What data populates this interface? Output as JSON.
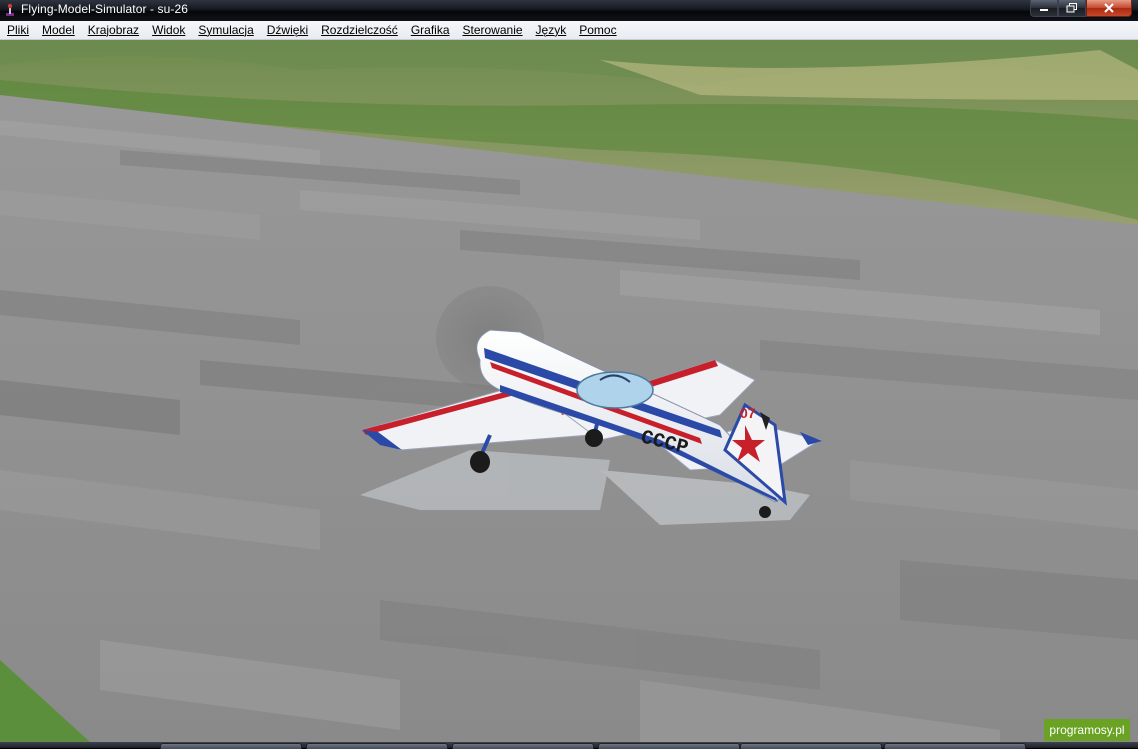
{
  "window": {
    "title": "Flying-Model-Simulator - su-26",
    "controls": [
      "minimize",
      "maximize",
      "close"
    ]
  },
  "menu": {
    "items": [
      {
        "label": "Pliki"
      },
      {
        "label": "Model"
      },
      {
        "label": "Krajobraz"
      },
      {
        "label": "Widok"
      },
      {
        "label": "Symulacja"
      },
      {
        "label": "Dźwięki"
      },
      {
        "label": "Rozdzielczość"
      },
      {
        "label": "Grafika"
      },
      {
        "label": "Sterowanie"
      },
      {
        "label": "Język"
      },
      {
        "label": "Pomoc"
      }
    ]
  },
  "scene": {
    "aircraft_livery": "CCCP",
    "tail_number": "07",
    "colors": {
      "grass": "#5f8a3a",
      "runway": "#8e8e8e",
      "fuselage": "#f4f6fa",
      "stripe_blue": "#2b4aa8",
      "stripe_red": "#c8202a"
    }
  },
  "watermark": {
    "text": "programosy.pl",
    "color": "#6aa323"
  }
}
